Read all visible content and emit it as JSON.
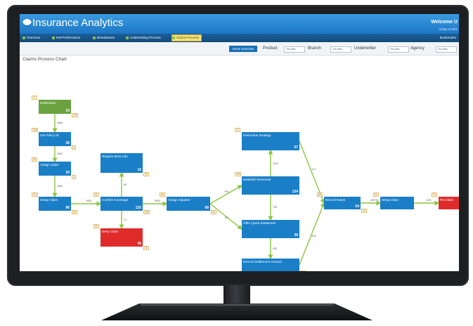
{
  "app": {
    "title": "Insurance Analytics",
    "welcome": "Welcome U",
    "today": "Today is 05/1",
    "brand_color": "#1d77c6"
  },
  "nav": {
    "items": [
      {
        "label": "Overview",
        "icon": "home-icon"
      },
      {
        "label": "KM Performance",
        "icon": "chart-icon"
      },
      {
        "label": "Breakdowns",
        "icon": "breakdown-icon"
      },
      {
        "label": "Underwriting Process",
        "icon": "process-icon"
      },
      {
        "label": "Claims Process",
        "icon": "claims-icon",
        "active": true
      }
    ],
    "bookmarks": "Bookmarks"
  },
  "filters": {
    "home_selection": "Home Selection",
    "items": [
      {
        "label": "Product",
        "value": "You filter"
      },
      {
        "label": "Branch",
        "value": "You filter"
      },
      {
        "label": "Underwriter",
        "value": "You filter"
      },
      {
        "label": "Agency",
        "value": "You filter"
      }
    ]
  },
  "chart": {
    "title": "Claims Process Chart",
    "colors": {
      "start": "#6aa23f",
      "step": "#1a7fc7",
      "end": "#e02b2b",
      "edge": "#8cc63f"
    },
    "nodes": [
      {
        "id": "notification",
        "label": "Notification",
        "value": "24",
        "tag_in": "17",
        "tag_out": "147",
        "kind": "start"
      },
      {
        "id": "policy",
        "label": "Get Policy ID",
        "value": "36",
        "tag_in": "194",
        "tag_out": "4",
        "kind": "step"
      },
      {
        "id": "assign-claim",
        "label": "Assign Claim",
        "value": "30",
        "tag_in": "30",
        "tag_out": "5",
        "kind": "step"
      },
      {
        "id": "setup-claim",
        "label": "Setup Claim",
        "value": "96",
        "tag_in": "111",
        "tag_out": "33",
        "kind": "step"
      },
      {
        "id": "more-info",
        "label": "Require More Info",
        "value": "15",
        "tag_in": "",
        "tag_out": "25",
        "kind": "step"
      },
      {
        "id": "confirm",
        "label": "Confirm Coverage",
        "value": "125",
        "tag_in": "31",
        "tag_out": "123",
        "kind": "step"
      },
      {
        "id": "deny",
        "label": "Deny Claim",
        "value": "45",
        "tag_in": "29",
        "tag_out": "30",
        "kind": "end"
      },
      {
        "id": "adjuster",
        "label": "Assign Adjuster",
        "value": "68",
        "tag_in": "40",
        "tag_out": "51",
        "kind": "step"
      },
      {
        "id": "strategy",
        "label": "Determine Strategy",
        "value": "67",
        "tag_in": "14",
        "tag_out": "",
        "kind": "step"
      },
      {
        "id": "reserves",
        "label": "Establish Reserves",
        "value": "134",
        "tag_in": "129",
        "tag_out": "",
        "kind": "step"
      },
      {
        "id": "quick",
        "label": "Offer Quick Settlement",
        "value": "38",
        "tag_in": "",
        "tag_out": "",
        "kind": "step"
      },
      {
        "id": "record-amount",
        "label": "Record Settlement Amount",
        "value": "",
        "tag_in": "",
        "tag_out": "20",
        "kind": "step"
      },
      {
        "id": "record-notes",
        "label": "Record Notes",
        "value": "54",
        "tag_in": "68",
        "tag_out": "23",
        "kind": "step"
      },
      {
        "id": "setup-diary",
        "label": "Setup Diary",
        "value": "",
        "tag_in": "23",
        "tag_out": "",
        "kind": "step"
      },
      {
        "id": "re-claim",
        "label": "Re-Claim",
        "value": "",
        "tag_in": "13",
        "tag_out": "",
        "kind": "end"
      }
    ],
    "edge_labels": [
      "1960",
      "1962",
      "1963",
      "1950",
      "95",
      "73",
      "5000",
      "975",
      "317",
      "1012",
      "725",
      "433",
      "147",
      "578",
      "2597%",
      "10%"
    ]
  }
}
